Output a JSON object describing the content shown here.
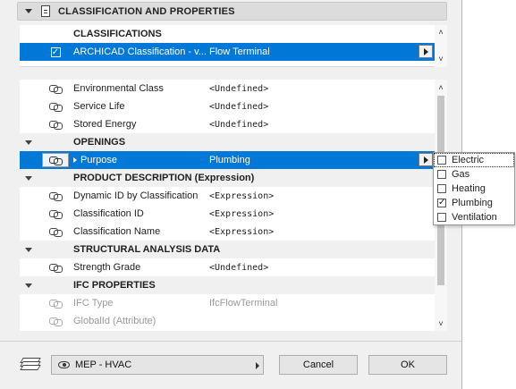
{
  "section": {
    "title": "CLASSIFICATION AND PROPERTIES"
  },
  "classifications": {
    "header": "CLASSIFICATIONS",
    "row": {
      "name": "ARCHICAD Classification - v...",
      "value": "Flow Terminal",
      "checked": true
    }
  },
  "properties": {
    "rows": [
      {
        "type": "prop",
        "name": "Environmental Class",
        "value": "<Undefined>"
      },
      {
        "type": "prop",
        "name": "Service Life",
        "value": "<Undefined>"
      },
      {
        "type": "prop",
        "name": "Stored Energy",
        "value": "<Undefined>"
      },
      {
        "type": "group",
        "name": "OPENINGS"
      },
      {
        "type": "selected",
        "name": "Purpose",
        "value": "Plumbing"
      },
      {
        "type": "group",
        "name": "PRODUCT DESCRIPTION (Expression)"
      },
      {
        "type": "prop",
        "name": "Dynamic ID by Classification",
        "value": "<Expression>"
      },
      {
        "type": "prop",
        "name": "Classification ID",
        "value": "<Expression>"
      },
      {
        "type": "prop",
        "name": "Classification Name",
        "value": "<Expression>"
      },
      {
        "type": "group",
        "name": "STRUCTURAL ANALYSIS DATA"
      },
      {
        "type": "prop",
        "name": "Strength Grade",
        "value": "<Undefined>"
      },
      {
        "type": "group",
        "name": "IFC PROPERTIES"
      },
      {
        "type": "disabled",
        "name": "IFC Type",
        "value": "IfcFlowTerminal"
      },
      {
        "type": "disabled",
        "name": "GlobalId (Attribute)",
        "value": ""
      }
    ]
  },
  "popup": {
    "options": [
      {
        "label": "Electric",
        "checked": false,
        "focused": true
      },
      {
        "label": "Gas",
        "checked": false,
        "focused": false
      },
      {
        "label": "Heating",
        "checked": false,
        "focused": false
      },
      {
        "label": "Plumbing",
        "checked": true,
        "focused": false
      },
      {
        "label": "Ventilation",
        "checked": false,
        "focused": false
      }
    ]
  },
  "footer": {
    "view_label": "MEP - HVAC",
    "cancel_label": "Cancel",
    "ok_label": "OK"
  },
  "icons": {
    "checkmark": "✓",
    "scroll_up": "˄",
    "scroll_down": "˅"
  }
}
